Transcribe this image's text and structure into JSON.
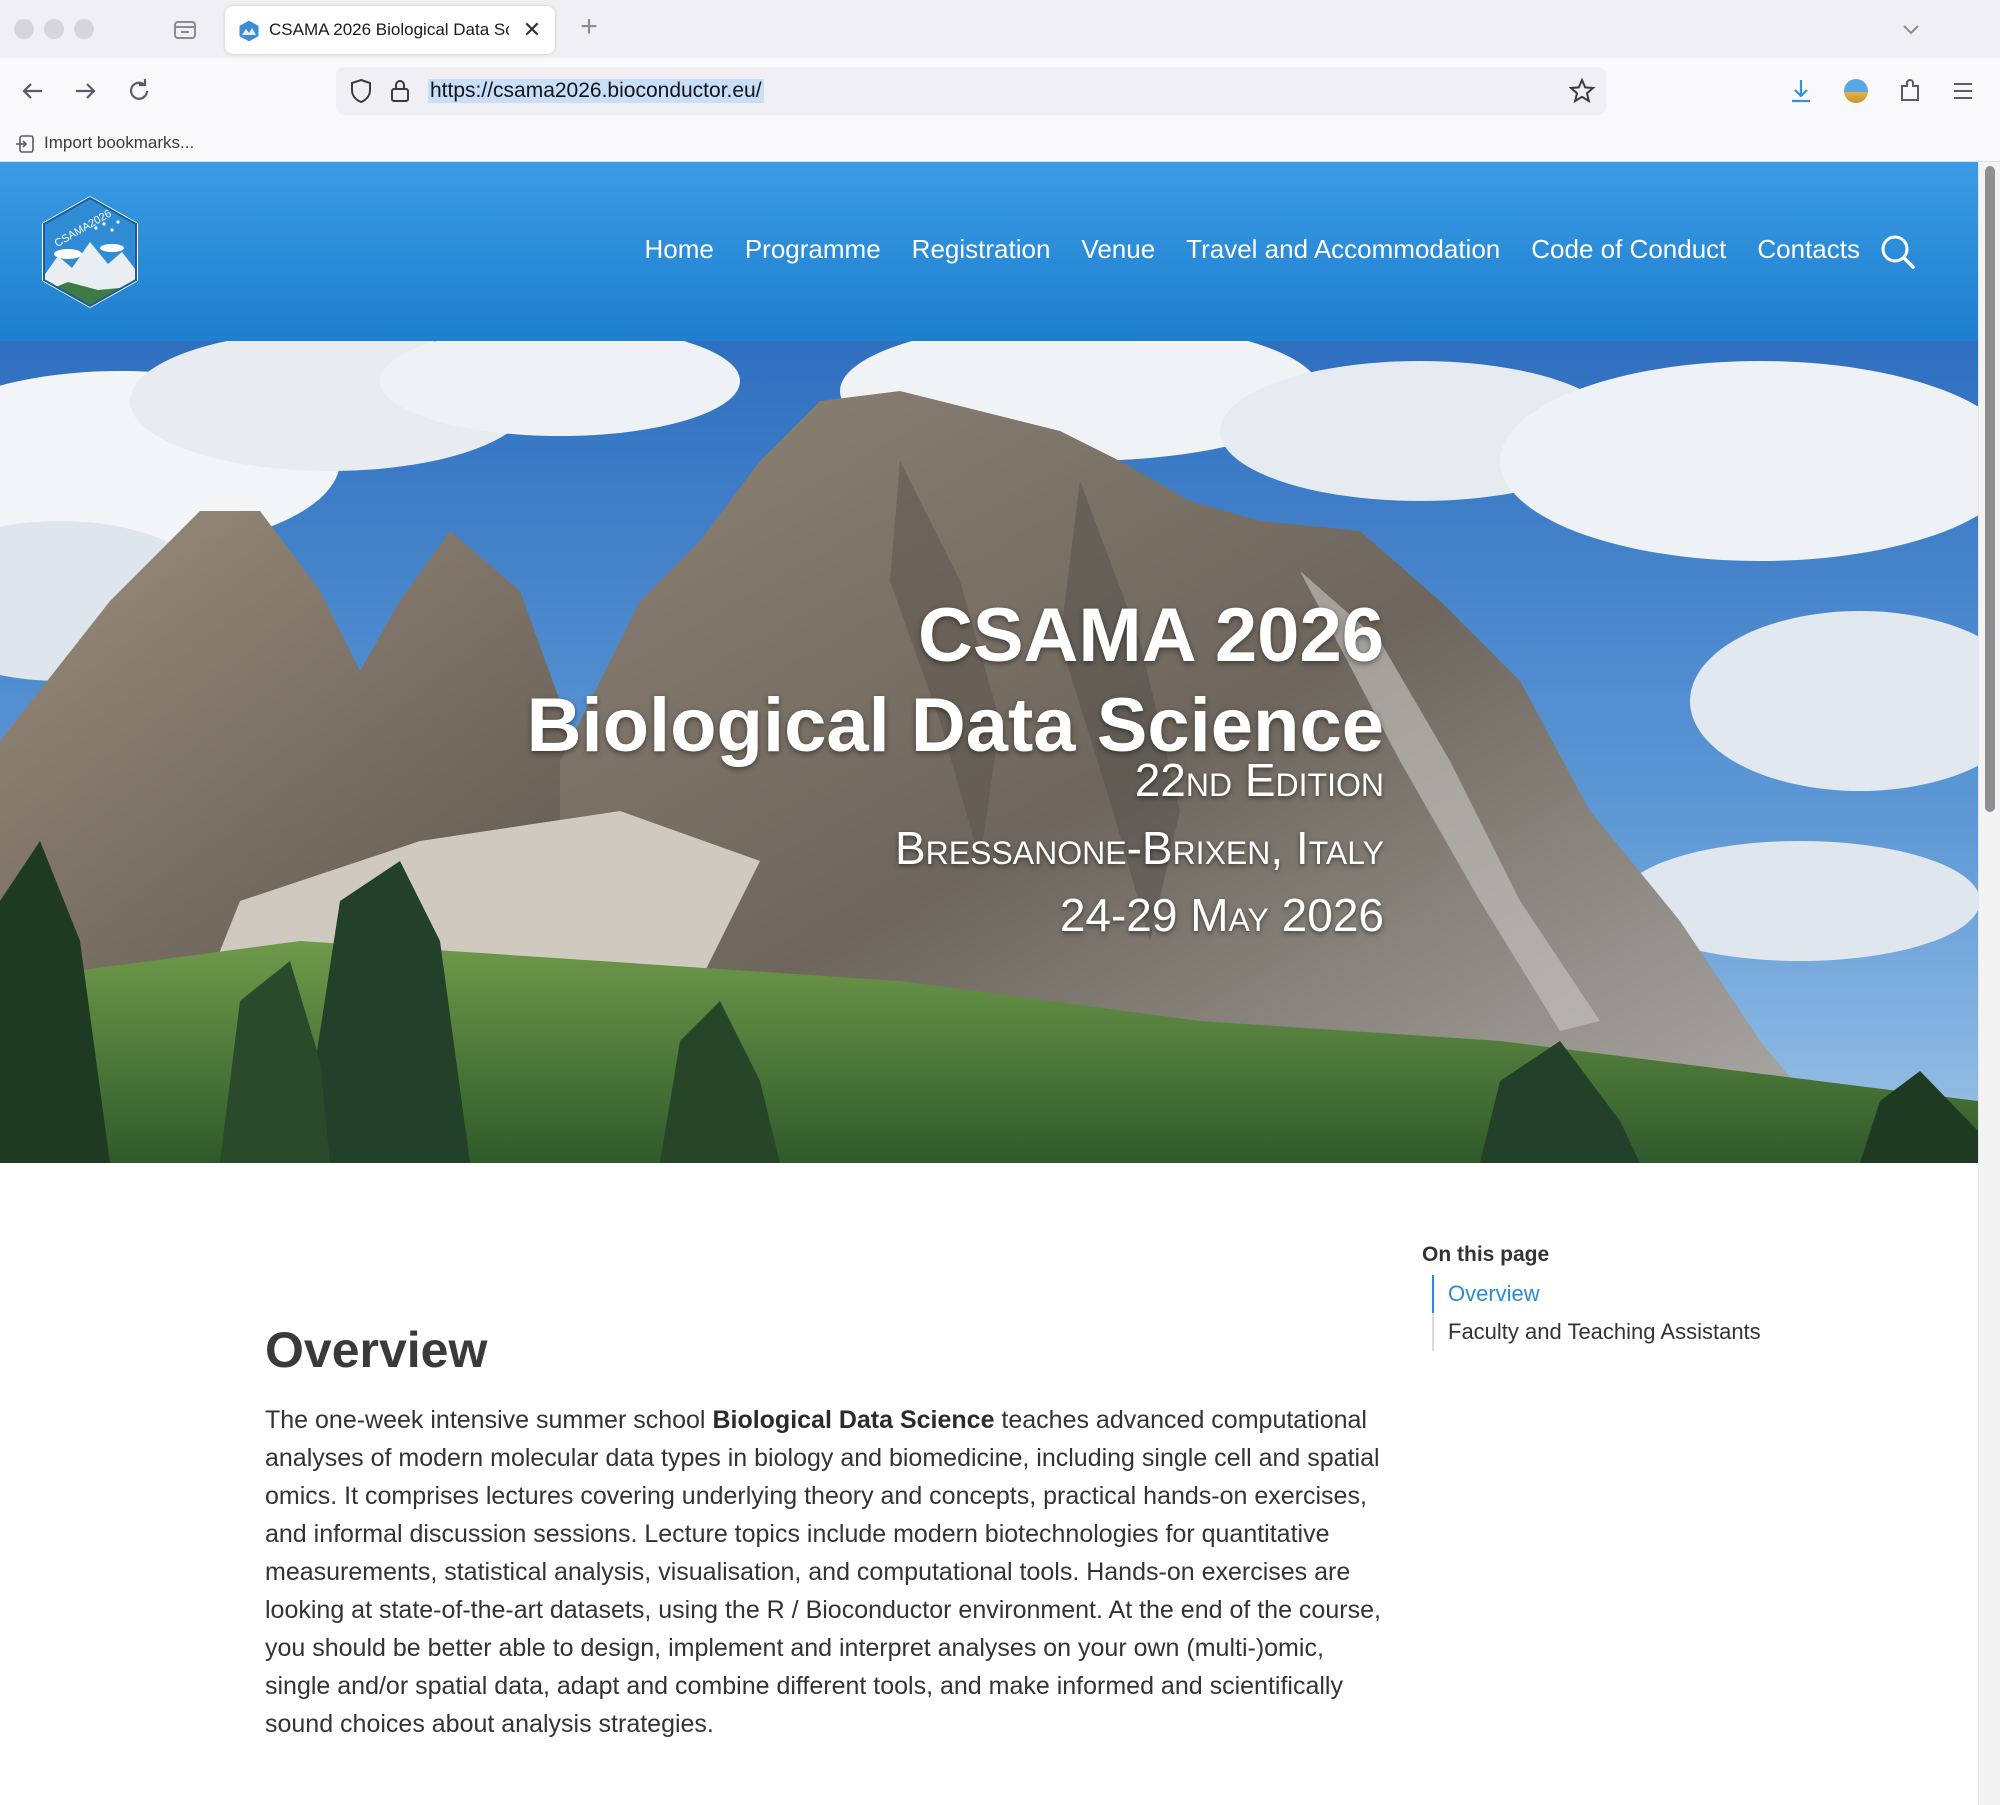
{
  "browser": {
    "tab_title": "CSAMA 2026 Biological Data Sc",
    "url": "https://csama2026.bioconductor.eu/",
    "bookmarks_item": "Import bookmarks..."
  },
  "site": {
    "menu": [
      "Home",
      "Programme",
      "Registration",
      "Venue",
      "Travel and Accommodation",
      "Code of Conduct",
      "Contacts"
    ],
    "logo_text": "CSAMA2026"
  },
  "hero": {
    "title_line1": "CSAMA 2026",
    "title_line2": "Biological Data Science",
    "edition": "22nd Edition",
    "location": "Bressanone-Brixen, Italy",
    "dates": "24-29 May 2026"
  },
  "toc": {
    "heading": "On this page",
    "items": [
      "Overview",
      "Faculty and Teaching Assistants"
    ]
  },
  "overview": {
    "title": "Overview",
    "text_before": "The one-week intensive summer school ",
    "text_bold": "Biological Data Science",
    "text_after": " teaches advanced computational analyses of modern molecular data types in biology and biomedicine, including single cell and spatial omics. It comprises lectures covering underlying theory and concepts, practical hands-on exercises, and informal discussion sessions. Lecture topics include modern biotechnologies for quantitative measurements, statistical analysis, visualisation, and computational tools. Hands-on exercises are looking at state-of-the-art datasets, using the R / Bioconductor environment. At the end of the course, you should be better able to design, implement and interpret analyses on your own (multi-)omic, single and/or spatial data, adapt and combine different tools, and make informed and scientifically sound choices about analysis strategies."
  },
  "colors": {
    "header_blue": "#2a8bd8",
    "link_blue": "#2a8bd8"
  }
}
